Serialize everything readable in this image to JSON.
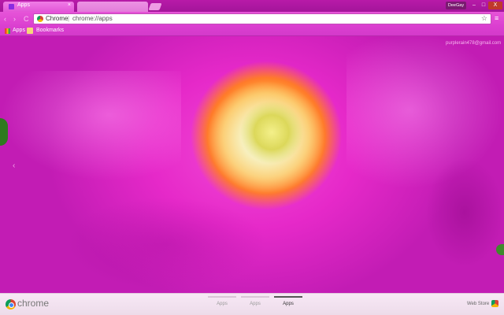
{
  "window": {
    "tabs": [
      {
        "title": "Apps",
        "close": "×",
        "active": true
      },
      {
        "title": "",
        "active": false
      }
    ],
    "profile_label": "DeeGay",
    "minimize": "–",
    "maximize": "□",
    "close": "X"
  },
  "toolbar": {
    "back": "‹",
    "forward": "›",
    "reload": "C",
    "omnibox_prefix": "Chrome",
    "separator": "|",
    "url": "chrome://apps",
    "star": "☆",
    "menu": "≡"
  },
  "bookmarks": {
    "apps": "Apps",
    "bookmarks": "Bookmarks"
  },
  "page": {
    "account_email": "purplerain478@gmail.com",
    "prev_arrow": "‹"
  },
  "bottom": {
    "brand": "chrome",
    "pages": [
      {
        "label": "Apps",
        "active": false
      },
      {
        "label": "Apps",
        "active": false
      },
      {
        "label": "Apps",
        "active": true
      }
    ],
    "webstore": "Web Store"
  },
  "colors": {
    "theme_pink": "#e629c9",
    "titlebar": "#b81aa8",
    "bottom_bar": "#f7e8f5"
  }
}
